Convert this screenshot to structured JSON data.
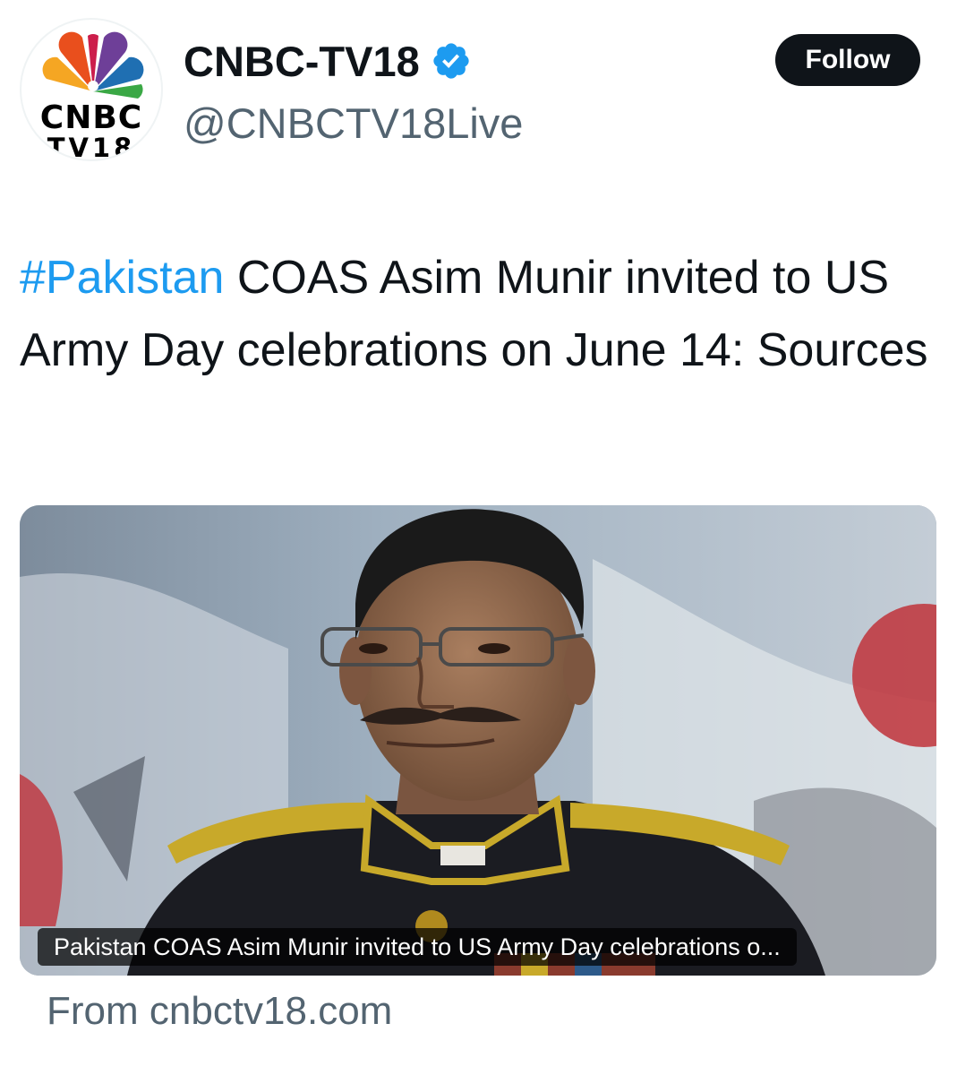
{
  "account": {
    "display_name": "CNBC-TV18",
    "handle": "@CNBCTV18Live",
    "verified": true,
    "logo_line1": "CNBC",
    "logo_line2": "TV18"
  },
  "follow_label": "Follow",
  "tweet": {
    "hashtag": "#Pakistan",
    "text": " COAS Asim Munir invited to US Army Day celebrations on June 14: Sources"
  },
  "card": {
    "caption": "Pakistan COAS Asim Munir invited to US Army Day celebrations o...",
    "source": "From cnbctv18.com"
  },
  "colors": {
    "link_blue": "#1d9bf0",
    "button_bg": "#0f1419",
    "secondary_text": "#536471"
  },
  "icons": [
    "cnbc-peacock-icon",
    "verified-badge-icon"
  ]
}
